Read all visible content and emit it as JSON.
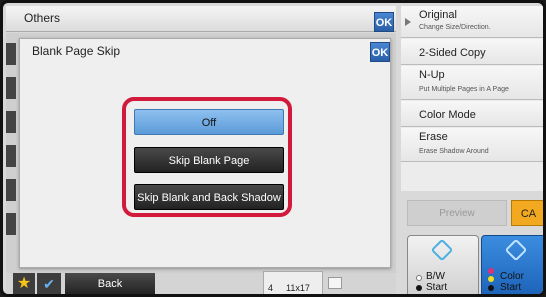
{
  "others": {
    "title": "Others",
    "ok_label": "OK"
  },
  "dialog": {
    "title": "Blank Page Skip",
    "ok_label": "OK",
    "options": [
      "Off",
      "Skip Blank Page",
      "Skip Blank and Back Shadow"
    ],
    "selected": "Off"
  },
  "right_menu": {
    "items": [
      {
        "label": "Original",
        "sub": "Change Size/Direction."
      },
      {
        "label": "2-Sided Copy",
        "sub": ""
      },
      {
        "label": "N-Up",
        "sub": "Put Multiple Pages in A Page"
      },
      {
        "label": "Color Mode",
        "sub": ""
      },
      {
        "label": "Erase",
        "sub": "Erase Shadow Around"
      }
    ]
  },
  "preview_label": "Preview",
  "ca_label": "CA",
  "start": {
    "bw_label_1": "B/W",
    "bw_label_2": "Start",
    "color_label_1": "Color",
    "color_label_2": "Start"
  },
  "bottom": {
    "back_label": "Back",
    "paper_count": "4",
    "paper_size": "11x17"
  },
  "colors": {
    "accent_blue": "#2a5fa8",
    "highlight_red": "#d21a3c",
    "ca_orange": "#f2a81f",
    "selected_option": "#5c9bd8"
  }
}
